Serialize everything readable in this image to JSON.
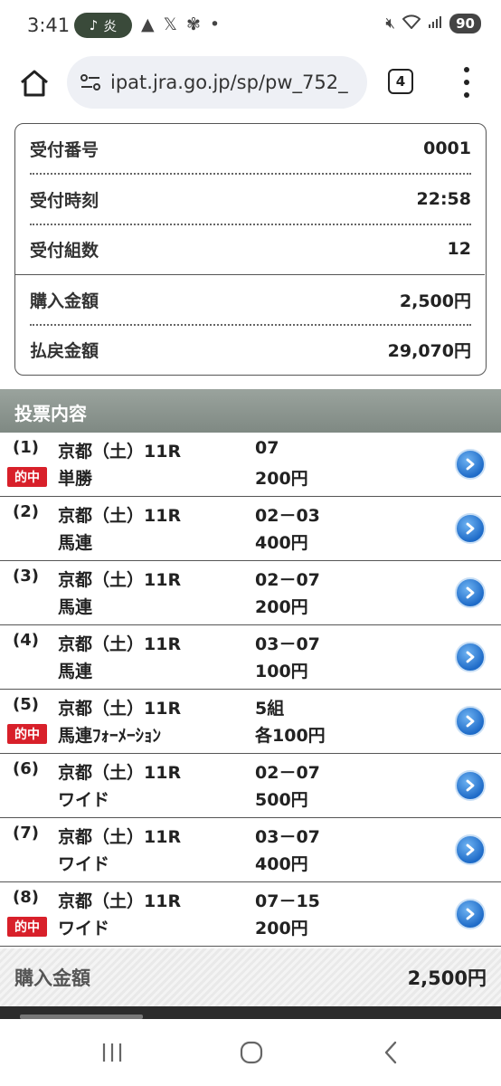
{
  "status_bar": {
    "time": "3:41",
    "pill_label": "炎",
    "icons": [
      "warning-icon",
      "x-logo-icon",
      "pinwheel-icon",
      "dot-icon"
    ],
    "battery": "90"
  },
  "browser": {
    "url": "ipat.jra.go.jp/sp/pw_752_",
    "tab_count": "4"
  },
  "summary": {
    "rows": [
      {
        "label": "受付番号",
        "value": "0001"
      },
      {
        "label": "受付時刻",
        "value": "22:58"
      },
      {
        "label": "受付組数",
        "value": "12"
      },
      {
        "label": "購入金額",
        "value": "2,500円"
      },
      {
        "label": "払戻金額",
        "value": "29,070円"
      }
    ]
  },
  "section_title": "投票内容",
  "bets": [
    {
      "num": "(1)",
      "hit": "的中",
      "race": "京都（土）11R",
      "type": "単勝",
      "combo": "07",
      "amount": "200円"
    },
    {
      "num": "(2)",
      "hit": "",
      "race": "京都（土）11R",
      "type": "馬連",
      "combo": "02－03",
      "amount": "400円"
    },
    {
      "num": "(3)",
      "hit": "",
      "race": "京都（土）11R",
      "type": "馬連",
      "combo": "02－07",
      "amount": "200円"
    },
    {
      "num": "(4)",
      "hit": "",
      "race": "京都（土）11R",
      "type": "馬連",
      "combo": "03－07",
      "amount": "100円"
    },
    {
      "num": "(5)",
      "hit": "的中",
      "race": "京都（土）11R",
      "type": "馬連ﾌｫｰﾒｰｼｮﾝ",
      "combo": "5組",
      "amount": "各100円"
    },
    {
      "num": "(6)",
      "hit": "",
      "race": "京都（土）11R",
      "type": "ワイド",
      "combo": "02－07",
      "amount": "500円"
    },
    {
      "num": "(7)",
      "hit": "",
      "race": "京都（土）11R",
      "type": "ワイド",
      "combo": "03－07",
      "amount": "400円"
    },
    {
      "num": "(8)",
      "hit": "的中",
      "race": "京都（土）11R",
      "type": "ワイド",
      "combo": "07－15",
      "amount": "200円"
    }
  ],
  "total": {
    "label": "購入金額",
    "value": "2,500円"
  },
  "colors": {
    "hit_badge": "#d8202a",
    "section_header": "#8a938d",
    "arrow_button": "#1e6bc8"
  }
}
